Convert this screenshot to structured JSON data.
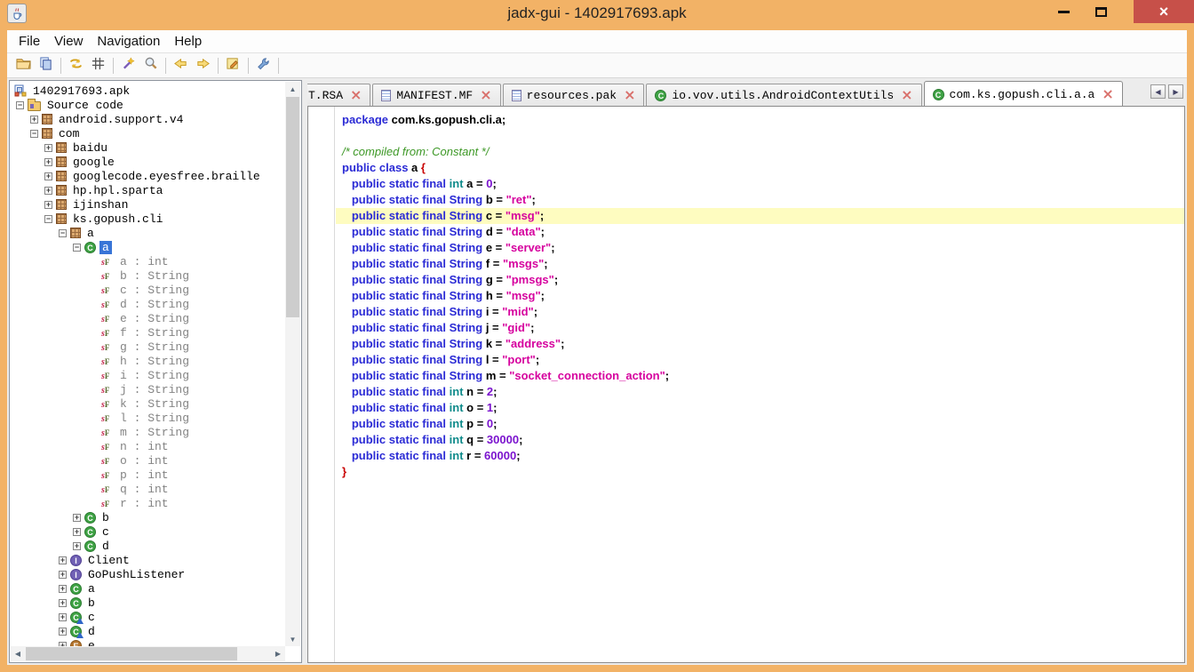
{
  "window": {
    "title": "jadx-gui - 1402917693.apk",
    "controls": {
      "close": "×"
    }
  },
  "menu": {
    "items": [
      "File",
      "View",
      "Navigation",
      "Help"
    ]
  },
  "toolbar": {
    "buttons": [
      {
        "icon": "open-file"
      },
      {
        "icon": "save-all"
      },
      {
        "sep": true
      },
      {
        "icon": "sync"
      },
      {
        "icon": "flat-packages"
      },
      {
        "sep": true
      },
      {
        "icon": "deobfuscation"
      },
      {
        "icon": "search"
      },
      {
        "sep": true
      },
      {
        "icon": "back"
      },
      {
        "icon": "forward"
      },
      {
        "sep": true
      },
      {
        "icon": "log-viewer"
      },
      {
        "sep": true
      },
      {
        "icon": "preferences"
      },
      {
        "sep": true
      }
    ]
  },
  "tree": {
    "nodes": [
      {
        "label": "1402917693.apk",
        "type": "apk",
        "depth": 0
      },
      {
        "label": "Source code",
        "type": "folder",
        "depth": 1,
        "toggle": "-"
      },
      {
        "label": "android.support.v4",
        "type": "package",
        "depth": 2,
        "toggle": "+"
      },
      {
        "label": "com",
        "type": "package",
        "depth": 2,
        "toggle": "-"
      },
      {
        "label": "baidu",
        "type": "package",
        "depth": 3,
        "toggle": "+"
      },
      {
        "label": "google",
        "type": "package",
        "depth": 3,
        "toggle": "+"
      },
      {
        "label": "googlecode.eyesfree.braille",
        "type": "package",
        "depth": 3,
        "toggle": "+"
      },
      {
        "label": "hp.hpl.sparta",
        "type": "package",
        "depth": 3,
        "toggle": "+"
      },
      {
        "label": "ijinshan",
        "type": "package",
        "depth": 3,
        "toggle": "+"
      },
      {
        "label": "ks.gopush.cli",
        "type": "package",
        "depth": 3,
        "toggle": "-"
      },
      {
        "label": "a",
        "type": "package",
        "depth": 4,
        "toggle": "-"
      },
      {
        "label": "a",
        "type": "class",
        "depth": 5,
        "toggle": "-",
        "selected": true
      },
      {
        "label": "a : int",
        "type": "field",
        "depth": 6
      },
      {
        "label": "b : String",
        "type": "field",
        "depth": 6
      },
      {
        "label": "c : String",
        "type": "field",
        "depth": 6
      },
      {
        "label": "d : String",
        "type": "field",
        "depth": 6
      },
      {
        "label": "e : String",
        "type": "field",
        "depth": 6
      },
      {
        "label": "f : String",
        "type": "field",
        "depth": 6
      },
      {
        "label": "g : String",
        "type": "field",
        "depth": 6
      },
      {
        "label": "h : String",
        "type": "field",
        "depth": 6
      },
      {
        "label": "i : String",
        "type": "field",
        "depth": 6
      },
      {
        "label": "j : String",
        "type": "field",
        "depth": 6
      },
      {
        "label": "k : String",
        "type": "field",
        "depth": 6
      },
      {
        "label": "l : String",
        "type": "field",
        "depth": 6
      },
      {
        "label": "m : String",
        "type": "field",
        "depth": 6
      },
      {
        "label": "n : int",
        "type": "field",
        "depth": 6
      },
      {
        "label": "o : int",
        "type": "field",
        "depth": 6
      },
      {
        "label": "p : int",
        "type": "field",
        "depth": 6
      },
      {
        "label": "q : int",
        "type": "field",
        "depth": 6
      },
      {
        "label": "r : int",
        "type": "field",
        "depth": 6
      },
      {
        "label": "b",
        "type": "class",
        "depth": 5,
        "toggle": "+"
      },
      {
        "label": "c",
        "type": "class",
        "depth": 5,
        "toggle": "+"
      },
      {
        "label": "d",
        "type": "class",
        "depth": 5,
        "toggle": "+"
      },
      {
        "label": "Client",
        "type": "interface",
        "depth": 4,
        "toggle": "+"
      },
      {
        "label": "GoPushListener",
        "type": "interface",
        "depth": 4,
        "toggle": "+"
      },
      {
        "label": "a",
        "type": "class",
        "depth": 4,
        "toggle": "+"
      },
      {
        "label": "b",
        "type": "class",
        "depth": 4,
        "toggle": "+"
      },
      {
        "label": "c",
        "type": "class",
        "depth": 4,
        "toggle": "+",
        "badge": true
      },
      {
        "label": "d",
        "type": "class",
        "depth": 4,
        "toggle": "+",
        "badge": true
      },
      {
        "label": "e",
        "type": "enum",
        "depth": 4,
        "toggle": "+"
      }
    ]
  },
  "tabs": {
    "close_glyph": "×",
    "scroll_left": "◀",
    "scroll_right": "▶",
    "items": [
      {
        "label": "T.RSA",
        "icon": null,
        "active": false,
        "clipped": true
      },
      {
        "label": "MANIFEST.MF",
        "icon": "file",
        "active": false
      },
      {
        "label": "resources.pak",
        "icon": "file",
        "active": false
      },
      {
        "label": "io.vov.utils.AndroidContextUtils",
        "icon": "class",
        "active": false
      },
      {
        "label": "com.ks.gopush.cli.a.a",
        "icon": "class",
        "active": true
      }
    ]
  },
  "scrollbar": {
    "up": "▲",
    "down": "▼",
    "left": "◀",
    "right": "▶"
  },
  "code": {
    "lines": [
      {
        "hl": false,
        "spans": [
          [
            "k",
            "package "
          ],
          [
            "p",
            "com.ks.gopush.cli.a;"
          ]
        ]
      },
      {
        "hl": false,
        "spans": []
      },
      {
        "hl": false,
        "spans": [
          [
            "c",
            "/* compiled from: Constant */"
          ]
        ]
      },
      {
        "hl": false,
        "spans": [
          [
            "k",
            "public class "
          ],
          [
            "p",
            "a "
          ],
          [
            "b",
            "{"
          ]
        ]
      },
      {
        "hl": false,
        "spans": [
          [
            "p",
            "   "
          ],
          [
            "k",
            "public static final "
          ],
          [
            "t",
            "int"
          ],
          [
            "p",
            " a = "
          ],
          [
            "n",
            "0"
          ],
          [
            "p",
            ";"
          ]
        ]
      },
      {
        "hl": false,
        "spans": [
          [
            "p",
            "   "
          ],
          [
            "k",
            "public static final String "
          ],
          [
            "p",
            "b = "
          ],
          [
            "s",
            "\"ret\""
          ],
          [
            "p",
            ";"
          ]
        ]
      },
      {
        "hl": true,
        "spans": [
          [
            "p",
            "   "
          ],
          [
            "k",
            "public static final String "
          ],
          [
            "p",
            "c = "
          ],
          [
            "s",
            "\"msg\""
          ],
          [
            "p",
            ";"
          ]
        ]
      },
      {
        "hl": false,
        "spans": [
          [
            "p",
            "   "
          ],
          [
            "k",
            "public static final String "
          ],
          [
            "p",
            "d = "
          ],
          [
            "s",
            "\"data\""
          ],
          [
            "p",
            ";"
          ]
        ]
      },
      {
        "hl": false,
        "spans": [
          [
            "p",
            "   "
          ],
          [
            "k",
            "public static final String "
          ],
          [
            "p",
            "e = "
          ],
          [
            "s",
            "\"server\""
          ],
          [
            "p",
            ";"
          ]
        ]
      },
      {
        "hl": false,
        "spans": [
          [
            "p",
            "   "
          ],
          [
            "k",
            "public static final String "
          ],
          [
            "p",
            "f = "
          ],
          [
            "s",
            "\"msgs\""
          ],
          [
            "p",
            ";"
          ]
        ]
      },
      {
        "hl": false,
        "spans": [
          [
            "p",
            "   "
          ],
          [
            "k",
            "public static final String "
          ],
          [
            "p",
            "g = "
          ],
          [
            "s",
            "\"pmsgs\""
          ],
          [
            "p",
            ";"
          ]
        ]
      },
      {
        "hl": false,
        "spans": [
          [
            "p",
            "   "
          ],
          [
            "k",
            "public static final String "
          ],
          [
            "p",
            "h = "
          ],
          [
            "s",
            "\"msg\""
          ],
          [
            "p",
            ";"
          ]
        ]
      },
      {
        "hl": false,
        "spans": [
          [
            "p",
            "   "
          ],
          [
            "k",
            "public static final String "
          ],
          [
            "p",
            "i = "
          ],
          [
            "s",
            "\"mid\""
          ],
          [
            "p",
            ";"
          ]
        ]
      },
      {
        "hl": false,
        "spans": [
          [
            "p",
            "   "
          ],
          [
            "k",
            "public static final String "
          ],
          [
            "p",
            "j = "
          ],
          [
            "s",
            "\"gid\""
          ],
          [
            "p",
            ";"
          ]
        ]
      },
      {
        "hl": false,
        "spans": [
          [
            "p",
            "   "
          ],
          [
            "k",
            "public static final String "
          ],
          [
            "p",
            "k = "
          ],
          [
            "s",
            "\"address\""
          ],
          [
            "p",
            ";"
          ]
        ]
      },
      {
        "hl": false,
        "spans": [
          [
            "p",
            "   "
          ],
          [
            "k",
            "public static final String "
          ],
          [
            "p",
            "l = "
          ],
          [
            "s",
            "\"port\""
          ],
          [
            "p",
            ";"
          ]
        ]
      },
      {
        "hl": false,
        "spans": [
          [
            "p",
            "   "
          ],
          [
            "k",
            "public static final String "
          ],
          [
            "p",
            "m = "
          ],
          [
            "s",
            "\"socket_connection_action\""
          ],
          [
            "p",
            ";"
          ]
        ]
      },
      {
        "hl": false,
        "spans": [
          [
            "p",
            "   "
          ],
          [
            "k",
            "public static final "
          ],
          [
            "t",
            "int"
          ],
          [
            "p",
            " n = "
          ],
          [
            "n",
            "2"
          ],
          [
            "p",
            ";"
          ]
        ]
      },
      {
        "hl": false,
        "spans": [
          [
            "p",
            "   "
          ],
          [
            "k",
            "public static final "
          ],
          [
            "t",
            "int"
          ],
          [
            "p",
            " o = "
          ],
          [
            "n",
            "1"
          ],
          [
            "p",
            ";"
          ]
        ]
      },
      {
        "hl": false,
        "spans": [
          [
            "p",
            "   "
          ],
          [
            "k",
            "public static final "
          ],
          [
            "t",
            "int"
          ],
          [
            "p",
            " p = "
          ],
          [
            "n",
            "0"
          ],
          [
            "p",
            ";"
          ]
        ]
      },
      {
        "hl": false,
        "spans": [
          [
            "p",
            "   "
          ],
          [
            "k",
            "public static final "
          ],
          [
            "t",
            "int"
          ],
          [
            "p",
            " q = "
          ],
          [
            "n",
            "30000"
          ],
          [
            "p",
            ";"
          ]
        ]
      },
      {
        "hl": false,
        "spans": [
          [
            "p",
            "   "
          ],
          [
            "k",
            "public static final "
          ],
          [
            "t",
            "int"
          ],
          [
            "p",
            " r = "
          ],
          [
            "n",
            "60000"
          ],
          [
            "p",
            ";"
          ]
        ]
      },
      {
        "hl": false,
        "spans": [
          [
            "b",
            "}"
          ]
        ]
      }
    ]
  },
  "colors": {
    "titlebar": "#F2B266",
    "close": "#C75049",
    "selection": "#3875D7",
    "hl": "#FEFCC0",
    "kw": "#2B2BD5",
    "type": "#0F8B8B",
    "num": "#7B14CE",
    "str": "#D6009E",
    "brace": "#C80000",
    "comment": "#3D9826",
    "field-text": "#848484"
  }
}
